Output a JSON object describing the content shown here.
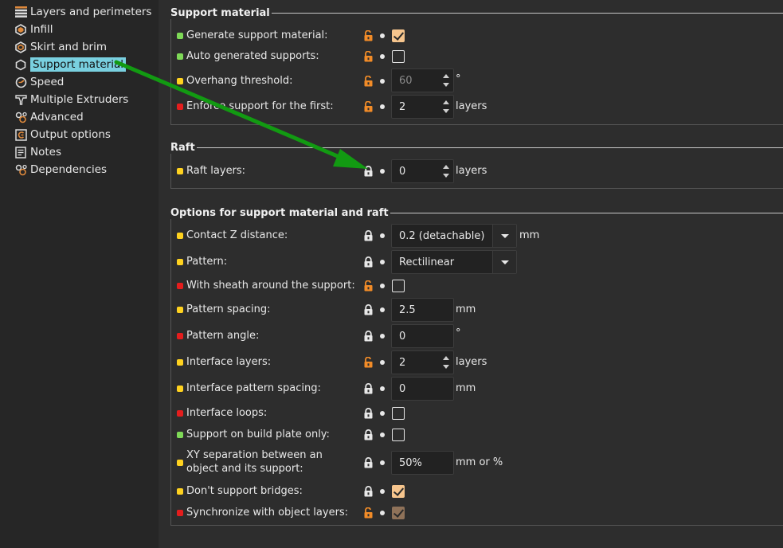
{
  "sidebar": {
    "items": [
      {
        "label": "Layers and perimeters",
        "icon": "layers-icon"
      },
      {
        "label": "Infill",
        "icon": "infill-icon"
      },
      {
        "label": "Skirt and brim",
        "icon": "skirt-icon"
      },
      {
        "label": "Support material",
        "icon": "support-icon",
        "selected": true
      },
      {
        "label": "Speed",
        "icon": "speed-icon"
      },
      {
        "label": "Multiple Extruders",
        "icon": "extruder-icon"
      },
      {
        "label": "Advanced",
        "icon": "advanced-icon"
      },
      {
        "label": "Output options",
        "icon": "output-icon"
      },
      {
        "label": "Notes",
        "icon": "notes-icon"
      },
      {
        "label": "Dependencies",
        "icon": "dependencies-icon"
      }
    ]
  },
  "colors": {
    "green": "#7ed957",
    "yellow": "#ffd21f",
    "red": "#e41d1d",
    "orange": "#f28c28",
    "accent": "#79d0e0",
    "check": "#f6c58d"
  },
  "groups": {
    "support": {
      "title": "Support material",
      "generate": {
        "label": "Generate support material:",
        "checked": true
      },
      "auto": {
        "label": "Auto generated supports:",
        "checked": false
      },
      "overhang": {
        "label": "Overhang threshold:",
        "value": "60",
        "unit": "°"
      },
      "enforce": {
        "label": "Enforce support for the first:",
        "value": "2",
        "unit": "layers"
      }
    },
    "raft": {
      "title": "Raft",
      "layers": {
        "label": "Raft layers:",
        "value": "0",
        "unit": "layers"
      }
    },
    "options": {
      "title": "Options for support material and raft",
      "contact_z": {
        "label": "Contact Z distance:",
        "value": "0.2 (detachable)",
        "unit": "mm"
      },
      "pattern": {
        "label": "Pattern:",
        "value": "Rectilinear"
      },
      "sheath": {
        "label": "With sheath around the support:",
        "checked": false
      },
      "spacing": {
        "label": "Pattern spacing:",
        "value": "2.5",
        "unit": "mm"
      },
      "angle": {
        "label": "Pattern angle:",
        "value": "0",
        "unit": "°"
      },
      "interface_layers": {
        "label": "Interface layers:",
        "value": "2",
        "unit": "layers"
      },
      "interface_spacing": {
        "label": "Interface pattern spacing:",
        "value": "0",
        "unit": "mm"
      },
      "interface_loops": {
        "label": "Interface loops:",
        "checked": false
      },
      "build_plate": {
        "label": "Support on build plate only:",
        "checked": false
      },
      "xy_sep_1": "XY separation between an",
      "xy_sep_2": "object and its support:",
      "xy_sep": {
        "value": "50%",
        "unit": "mm or %"
      },
      "bridges": {
        "label": "Don't support bridges:",
        "checked": true
      },
      "sync": {
        "label": "Synchronize with object layers:",
        "checked": true
      }
    }
  }
}
